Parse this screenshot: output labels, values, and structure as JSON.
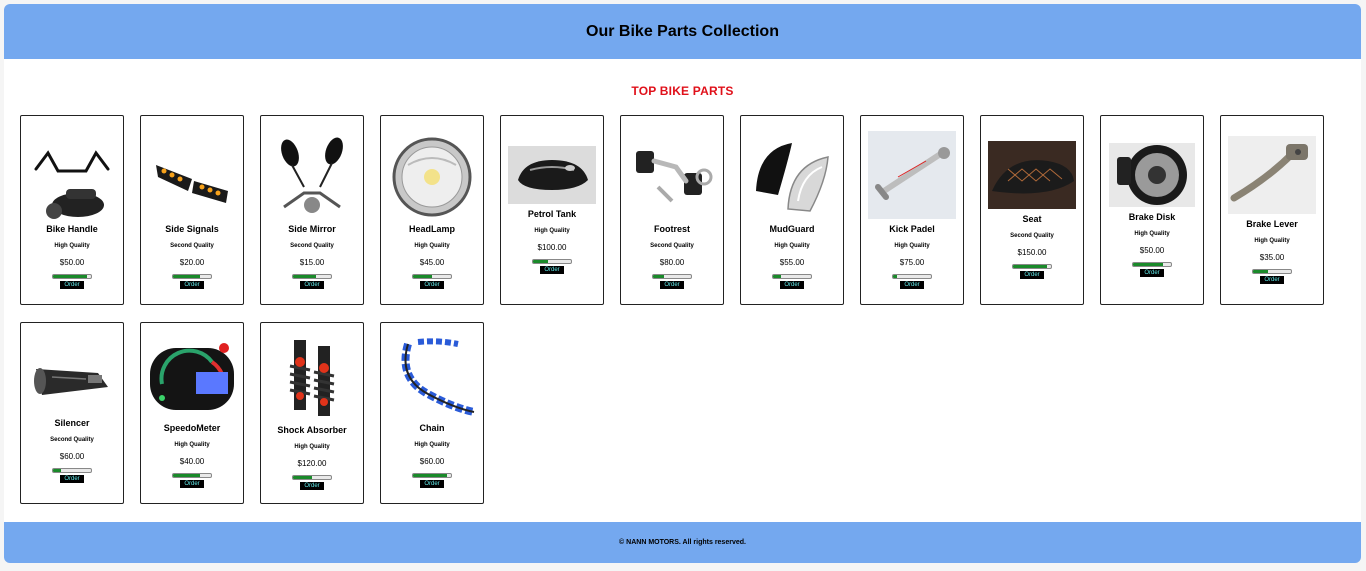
{
  "header": {
    "title": "Our Bike Parts Collection"
  },
  "section": {
    "title": "TOP BIKE PARTS"
  },
  "footer": {
    "text": "© NANN MOTORS. All rights reserved."
  },
  "products": [
    {
      "name": "Bike Handle",
      "quality": "High Quality",
      "price": "$50.00",
      "stock": 0.9,
      "order": "Order",
      "icon": "bike-handle-icon"
    },
    {
      "name": "Side Signals",
      "quality": "Second Quality",
      "price": "$20.00",
      "stock": 0.7,
      "order": "Order",
      "icon": "side-signals-icon"
    },
    {
      "name": "Side Mirror",
      "quality": "Second Quality",
      "price": "$15.00",
      "stock": 0.6,
      "order": "Order",
      "icon": "side-mirror-icon"
    },
    {
      "name": "HeadLamp",
      "quality": "High Quality",
      "price": "$45.00",
      "stock": 0.5,
      "order": "Order",
      "icon": "headlamp-icon"
    },
    {
      "name": "Petrol Tank",
      "quality": "High Quality",
      "price": "$100.00",
      "stock": 0.4,
      "order": "Order",
      "icon": "petrol-tank-icon"
    },
    {
      "name": "Footrest",
      "quality": "Second Quality",
      "price": "$80.00",
      "stock": 0.3,
      "order": "Order",
      "icon": "footrest-icon"
    },
    {
      "name": "MudGuard",
      "quality": "High Quality",
      "price": "$55.00",
      "stock": 0.2,
      "order": "Order",
      "icon": "mudguard-icon"
    },
    {
      "name": "Kick Padel",
      "quality": "High Quality",
      "price": "$75.00",
      "stock": 0.1,
      "order": "Order",
      "icon": "kick-pedal-icon"
    },
    {
      "name": "Seat",
      "quality": "Second Quality",
      "price": "$150.00",
      "stock": 0.9,
      "order": "Order",
      "icon": "seat-icon"
    },
    {
      "name": "Brake Disk",
      "quality": "High Quality",
      "price": "$50.00",
      "stock": 0.8,
      "order": "Order",
      "icon": "brake-disk-icon"
    },
    {
      "name": "Brake Lever",
      "quality": "High Quality",
      "price": "$35.00",
      "stock": 0.4,
      "order": "Order",
      "icon": "brake-lever-icon"
    },
    {
      "name": "Silencer",
      "quality": "Second Quality",
      "price": "$60.00",
      "stock": 0.2,
      "order": "Order",
      "icon": "silencer-icon"
    },
    {
      "name": "SpeedoMeter",
      "quality": "High Quality",
      "price": "$40.00",
      "stock": 0.7,
      "order": "Order",
      "icon": "speedometer-icon"
    },
    {
      "name": "Shock Absorber",
      "quality": "High Quality",
      "price": "$120.00",
      "stock": 0.5,
      "order": "Order",
      "icon": "shock-absorber-icon"
    },
    {
      "name": "Chain",
      "quality": "High Quality",
      "price": "$60.00",
      "stock": 0.9,
      "order": "Order",
      "icon": "chain-icon"
    }
  ]
}
